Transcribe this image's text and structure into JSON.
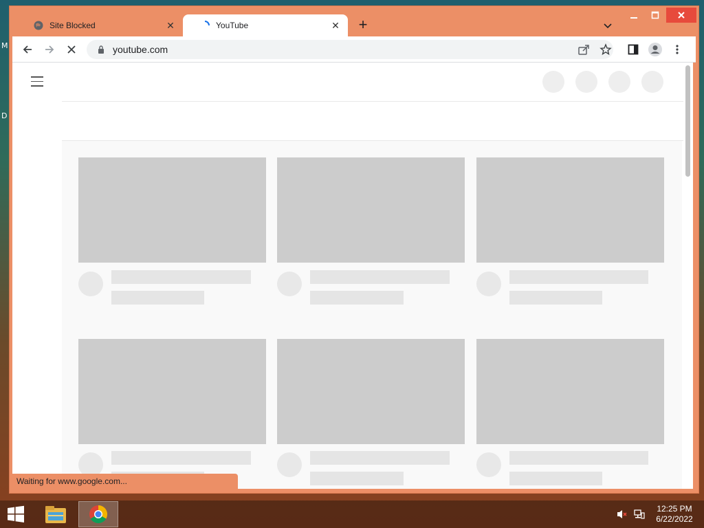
{
  "desktop": {
    "left_chars": [
      "M",
      "D"
    ]
  },
  "tabs": [
    {
      "title": "Site Blocked",
      "icon": "globe-icon",
      "active": false
    },
    {
      "title": "YouTube",
      "icon": "loading-spinner-icon",
      "active": true
    }
  ],
  "toolbar": {
    "url": "youtube.com"
  },
  "status": {
    "text": "Waiting for www.google.com..."
  },
  "taskbar": {
    "time": "12:25 PM",
    "date": "6/22/2022"
  },
  "colors": {
    "window_frame": "#ec8f66",
    "placeholder_thumb": "#cccccc",
    "close_button": "#e74a3c"
  }
}
